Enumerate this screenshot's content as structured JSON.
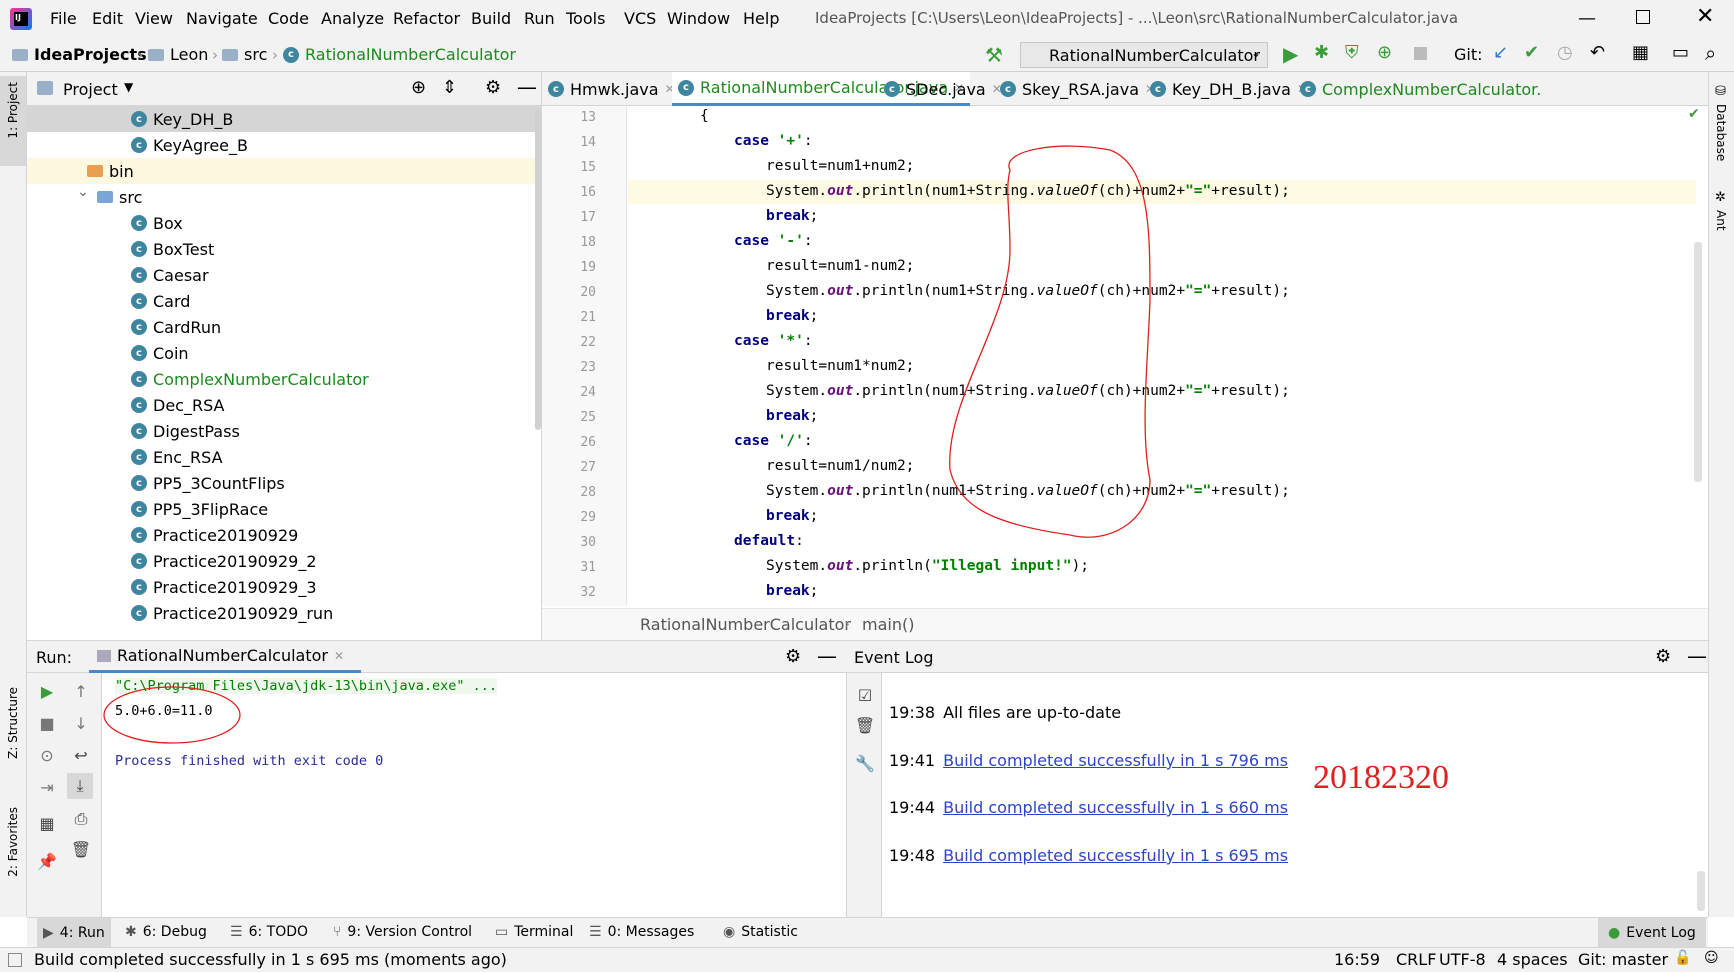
{
  "menubar": {
    "items": [
      "File",
      "Edit",
      "View",
      "Navigate",
      "Code",
      "Analyze",
      "Refactor",
      "Build",
      "Run",
      "Tools",
      "VCS",
      "Window",
      "Help"
    ],
    "title": "IdeaProjects [C:\\Users\\Leon\\IdeaProjects] - ...\\Leon\\src\\RationalNumberCalculator.java"
  },
  "navbar": {
    "crumbs": [
      "IdeaProjects",
      "Leon",
      "src",
      "RationalNumberCalculator"
    ],
    "run_config": "RationalNumberCalculator",
    "git_label": "Git:"
  },
  "side_tabs": {
    "project": "1: Project",
    "structure": "Z: Structure",
    "favorites": "2: Favorites",
    "database": "Database",
    "ant": "Ant"
  },
  "project": {
    "title": "Project",
    "tree": [
      {
        "label": "Key_DH_B",
        "type": "class",
        "indent": 1,
        "selected": true
      },
      {
        "label": "KeyAgree_B",
        "type": "class",
        "indent": 1
      },
      {
        "label": "bin",
        "type": "folder-orange",
        "indent": 0.6,
        "highlight": true
      },
      {
        "label": "src",
        "type": "folder",
        "indent": 0.6,
        "expanded": true
      },
      {
        "label": "Box",
        "type": "class",
        "indent": 1
      },
      {
        "label": "BoxTest",
        "type": "class",
        "indent": 1
      },
      {
        "label": "Caesar",
        "type": "class",
        "indent": 1
      },
      {
        "label": "Card",
        "type": "class",
        "indent": 1
      },
      {
        "label": "CardRun",
        "type": "class",
        "indent": 1
      },
      {
        "label": "Coin",
        "type": "class",
        "indent": 1
      },
      {
        "label": "ComplexNumberCalculator",
        "type": "class",
        "indent": 1,
        "green": true
      },
      {
        "label": "Dec_RSA",
        "type": "class",
        "indent": 1
      },
      {
        "label": "DigestPass",
        "type": "class",
        "indent": 1
      },
      {
        "label": "Enc_RSA",
        "type": "class",
        "indent": 1
      },
      {
        "label": "PP5_3CountFlips",
        "type": "class",
        "indent": 1
      },
      {
        "label": "PP5_3FlipRace",
        "type": "class",
        "indent": 1
      },
      {
        "label": "Practice20190929",
        "type": "class",
        "indent": 1
      },
      {
        "label": "Practice20190929_2",
        "type": "class",
        "indent": 1
      },
      {
        "label": "Practice20190929_3",
        "type": "class",
        "indent": 1
      },
      {
        "label": "Practice20190929_run",
        "type": "class",
        "indent": 1
      }
    ]
  },
  "editor": {
    "tabs": [
      {
        "label": "Hmwk.java"
      },
      {
        "label": "RationalNumberCalculator.java",
        "active": true
      },
      {
        "label": "SDec.java"
      },
      {
        "label": "Skey_RSA.java"
      },
      {
        "label": "Key_DH_B.java"
      },
      {
        "label": "ComplexNumberCalculator.",
        "green": true
      }
    ],
    "line_numbers": [
      "13",
      "14",
      "15",
      "16",
      "17",
      "18",
      "19",
      "20",
      "21",
      "22",
      "23",
      "24",
      "25",
      "26",
      "27",
      "28",
      "29",
      "30",
      "31",
      "32"
    ],
    "lines": [
      [
        [
          "",
          "{"
        ]
      ],
      [
        [
          "kw",
          "case"
        ],
        [
          "",
          " "
        ],
        [
          "str",
          "'+'"
        ],
        [
          "",
          ":"
        ]
      ],
      [
        [
          "",
          "result=num1+num2;"
        ]
      ],
      [
        [
          "",
          "System."
        ],
        [
          "fld",
          "out"
        ],
        [
          "",
          ".println(num1+String."
        ],
        [
          "it",
          "valueOf"
        ],
        [
          "",
          "(ch)+num2+"
        ],
        [
          "str",
          "\"=\""
        ],
        [
          "",
          "+result);"
        ]
      ],
      [
        [
          "kw",
          "break"
        ],
        [
          "",
          ";"
        ]
      ],
      [
        [
          "kw",
          "case"
        ],
        [
          "",
          " "
        ],
        [
          "str",
          "'-'"
        ],
        [
          "",
          ":"
        ]
      ],
      [
        [
          "",
          "result=num1-num2;"
        ]
      ],
      [
        [
          "",
          "System."
        ],
        [
          "fld",
          "out"
        ],
        [
          "",
          ".println(num1+String."
        ],
        [
          "it",
          "valueOf"
        ],
        [
          "",
          "(ch)+num2+"
        ],
        [
          "str",
          "\"=\""
        ],
        [
          "",
          "+result);"
        ]
      ],
      [
        [
          "kw",
          "break"
        ],
        [
          "",
          ";"
        ]
      ],
      [
        [
          "kw",
          "case"
        ],
        [
          "",
          " "
        ],
        [
          "str",
          "'*'"
        ],
        [
          "",
          ":"
        ]
      ],
      [
        [
          "",
          "result=num1*num2;"
        ]
      ],
      [
        [
          "",
          "System."
        ],
        [
          "fld",
          "out"
        ],
        [
          "",
          ".println(num1+String."
        ],
        [
          "it",
          "valueOf"
        ],
        [
          "",
          "(ch)+num2+"
        ],
        [
          "str",
          "\"=\""
        ],
        [
          "",
          "+result);"
        ]
      ],
      [
        [
          "kw",
          "break"
        ],
        [
          "",
          ";"
        ]
      ],
      [
        [
          "kw",
          "case"
        ],
        [
          "",
          " "
        ],
        [
          "str",
          "'/'"
        ],
        [
          "",
          ":"
        ]
      ],
      [
        [
          "",
          "result=num1/num2;"
        ]
      ],
      [
        [
          "",
          "System."
        ],
        [
          "fld",
          "out"
        ],
        [
          "",
          ".println(num1+String."
        ],
        [
          "it",
          "valueOf"
        ],
        [
          "",
          "(ch)+num2+"
        ],
        [
          "str",
          "\"=\""
        ],
        [
          "",
          "+result);"
        ]
      ],
      [
        [
          "kw",
          "break"
        ],
        [
          "",
          ";"
        ]
      ],
      [
        [
          "kw",
          "default"
        ],
        [
          "",
          ":"
        ]
      ],
      [
        [
          "",
          "System."
        ],
        [
          "fld",
          "out"
        ],
        [
          "",
          ".println("
        ],
        [
          "str",
          "\"Illegal input!\""
        ],
        [
          "",
          ");"
        ]
      ],
      [
        [
          "kw",
          "break"
        ],
        [
          "",
          ";"
        ]
      ]
    ],
    "line_indent": [
      0,
      1,
      2,
      2,
      2,
      1,
      2,
      2,
      2,
      1,
      2,
      2,
      2,
      1,
      2,
      2,
      2,
      1,
      2,
      2
    ],
    "breadcrumb": [
      "RationalNumberCalculator",
      "main()"
    ]
  },
  "run": {
    "label": "Run:",
    "tab": "RationalNumberCalculator",
    "cmd": "\"C:\\Program Files\\Java\\jdk-13\\bin\\java.exe\" ...",
    "output": "5.0+6.0=11.0",
    "finished": "Process finished with exit code 0"
  },
  "event_log": {
    "title": "Event Log",
    "entries": [
      {
        "time": "19:38",
        "text": "All files are up-to-date",
        "link": false
      },
      {
        "time": "19:41",
        "text": "Build completed successfully in 1 s 796 ms",
        "link": true
      },
      {
        "time": "19:44",
        "text": "Build completed successfully in 1 s 660 ms",
        "link": true
      },
      {
        "time": "19:48",
        "text": "Build completed successfully in 1 s 695 ms",
        "link": true
      }
    ],
    "annotation": "20182320"
  },
  "bottom_tabs": [
    "4: Run",
    "6: Debug",
    "6: TODO",
    "9: Version Control",
    "Terminal",
    "0: Messages",
    "Statistic"
  ],
  "event_log_button": "Event Log",
  "status": {
    "message": "Build completed successfully in 1 s 695 ms (moments ago)",
    "position": "16:59",
    "line_sep": "CRLF",
    "encoding": "UTF-8",
    "indent": "4 spaces",
    "git": "Git: master"
  },
  "colors": {
    "accent": "#3e86a0",
    "link": "#2a45c9",
    "annotation": "#e02020",
    "green": "#1e8a1e"
  }
}
